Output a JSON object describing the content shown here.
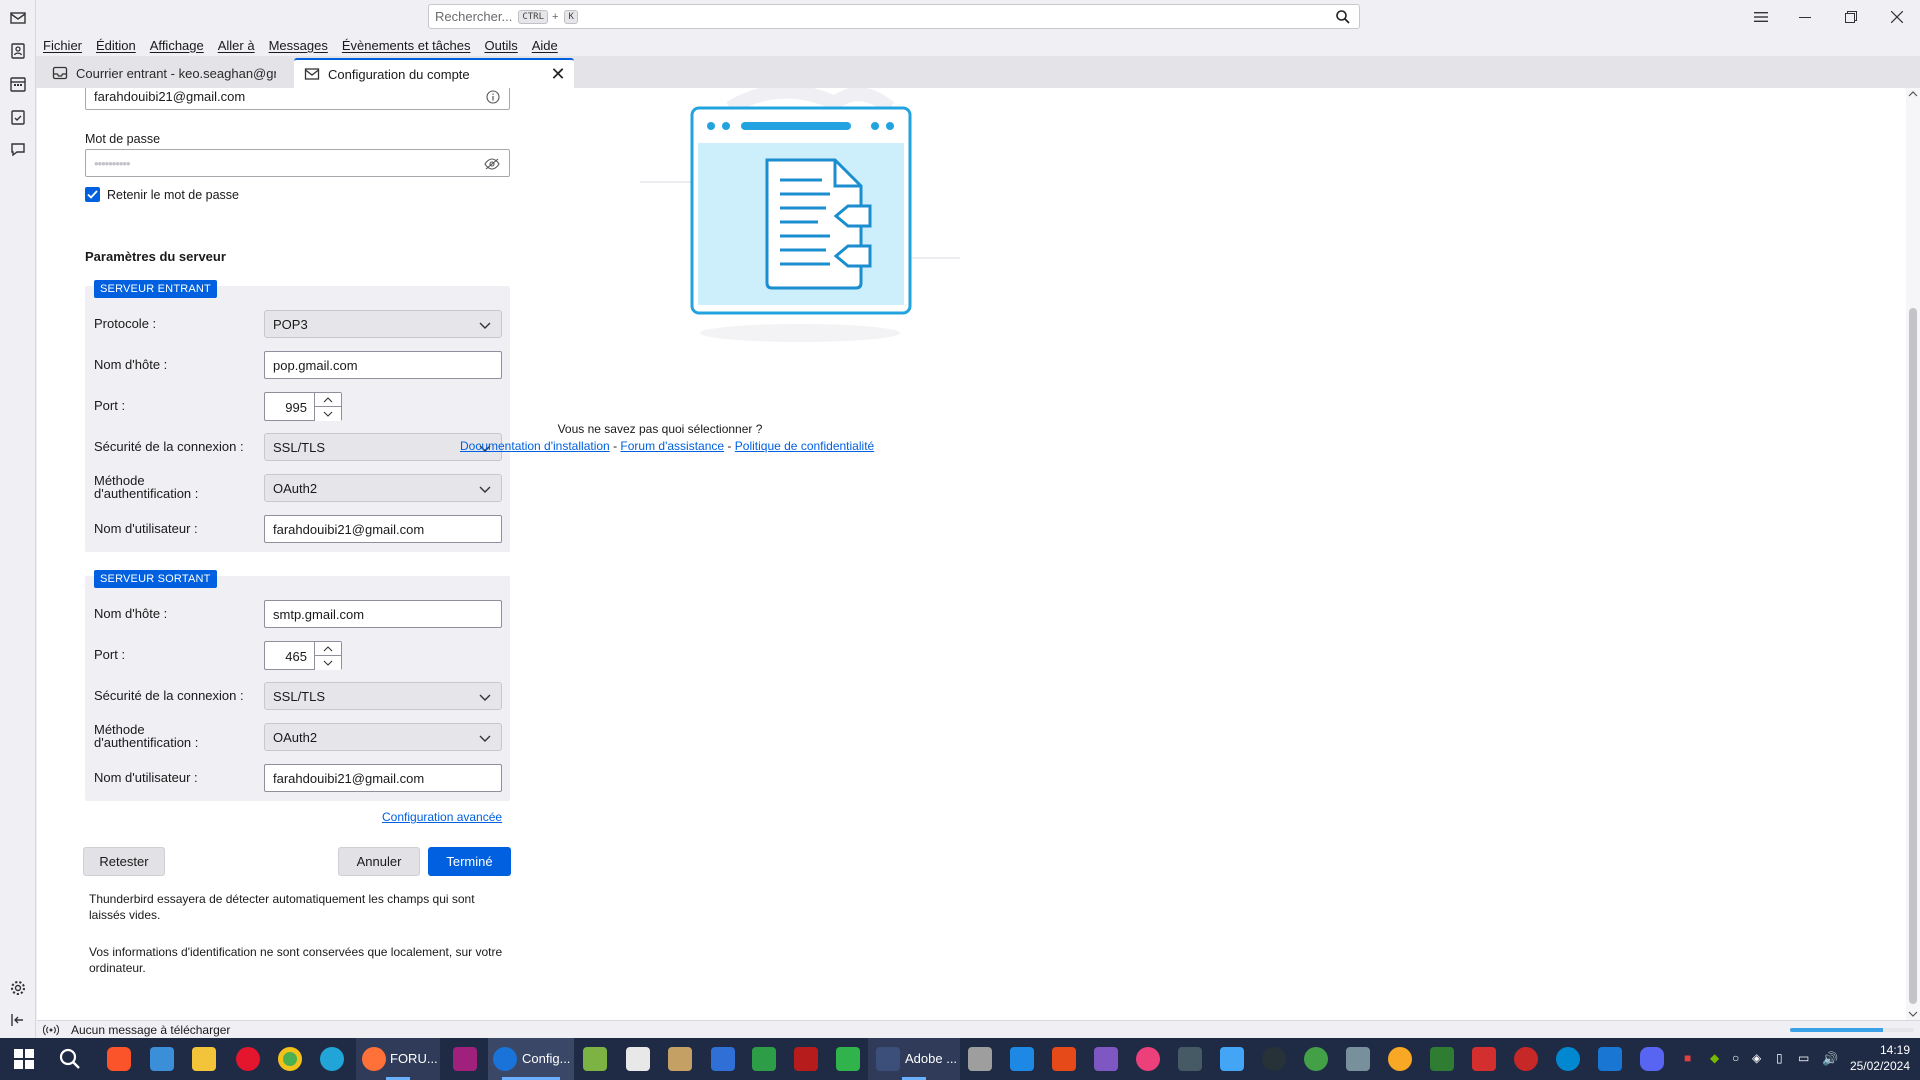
{
  "search": {
    "placeholder": "Rechercher...",
    "kbd_ctrl": "CTRL",
    "kbd_plus": "+",
    "kbd_k": "K"
  },
  "menu": [
    "Fichier",
    "Édition",
    "Affichage",
    "Aller à",
    "Messages",
    "Évènements et tâches",
    "Outils",
    "Aide"
  ],
  "tabs": {
    "inbox": "Courrier entrant - keo.seaghan@gmail.com",
    "config": "Configuration du compte"
  },
  "form": {
    "email_value": "farahdouibi21@gmail.com",
    "password_label": "Mot de passe",
    "password_value": "••••••••••",
    "remember_label": "Retenir le mot de passe",
    "server_settings_title": "Paramètres du serveur",
    "incoming": {
      "badge": "SERVEUR ENTRANT",
      "protocol_label": "Protocole :",
      "protocol_value": "POP3",
      "hostname_label": "Nom d'hôte :",
      "hostname_value": "pop.gmail.com",
      "port_label": "Port :",
      "port_value": "995",
      "security_label": "Sécurité de la connexion :",
      "security_value": "SSL/TLS",
      "auth_label_1": "Méthode",
      "auth_label_2": "d'authentification :",
      "auth_value": "OAuth2",
      "username_label": "Nom d'utilisateur :",
      "username_value": "farahdouibi21@gmail.com"
    },
    "outgoing": {
      "badge": "SERVEUR SORTANT",
      "hostname_label": "Nom d'hôte :",
      "hostname_value": "smtp.gmail.com",
      "port_label": "Port :",
      "port_value": "465",
      "security_label": "Sécurité de la connexion :",
      "security_value": "SSL/TLS",
      "auth_label_1": "Méthode",
      "auth_label_2": "d'authentification :",
      "auth_value": "OAuth2",
      "username_label": "Nom d'utilisateur :",
      "username_value": "farahdouibi21@gmail.com"
    },
    "advanced_link": "Configuration avancée",
    "retest_button": "Retester",
    "cancel_button": "Annuler",
    "done_button": "Terminé",
    "note_1": "Thunderbird essayera de détecter automatiquement les champs qui sont laissés vides.",
    "note_2": "Vos informations d'identification ne sont conservées que localement, sur votre ordinateur."
  },
  "help": {
    "question": "Vous ne savez pas quoi sélectionner ?",
    "doc_link": "Documentation d'installation",
    "sep": "-",
    "forum_link": "Forum d'assistance",
    "privacy_link": "Politique de confidentialité"
  },
  "status": {
    "text": "Aucun message à télécharger",
    "progress": 0.75
  },
  "taskbar": {
    "firefox_label": "FORU...",
    "thunderbird_label": "Config...",
    "adobe_label": "Adobe ...",
    "time": "14:19",
    "date": "25/02/2024"
  },
  "colors": {
    "accent": "#0060df",
    "taskbar": "#1f2a44",
    "illustration": "#22a3e0"
  }
}
